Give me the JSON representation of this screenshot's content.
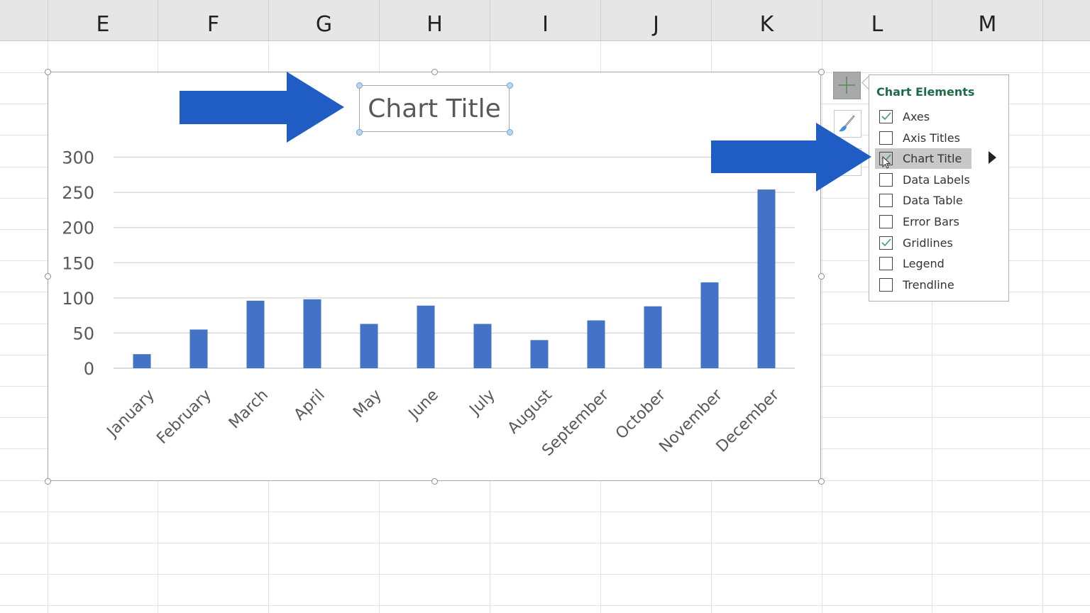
{
  "spreadsheet": {
    "columns": [
      "E",
      "F",
      "G",
      "H",
      "I",
      "J",
      "K",
      "L",
      "M"
    ]
  },
  "chart_data": {
    "type": "bar",
    "title": "Chart Title",
    "categories": [
      "January",
      "February",
      "March",
      "April",
      "May",
      "June",
      "July",
      "August",
      "September",
      "October",
      "November",
      "December"
    ],
    "values": [
      20,
      55,
      96,
      98,
      63,
      89,
      63,
      40,
      68,
      88,
      122,
      254
    ],
    "xlabel": "",
    "ylabel": "",
    "ylim": [
      0,
      300
    ],
    "yticks": [
      0,
      50,
      100,
      150,
      200,
      250,
      300
    ],
    "ytick_labels": [
      "0",
      "50",
      "100",
      "150",
      "200",
      "250",
      "300"
    ],
    "grid": true,
    "legend": "none",
    "bar_color": "#4472c4",
    "x_label_rotation_deg": -45
  },
  "chart_buttons": {
    "plus": "chart-elements-plus",
    "brush": "chart-styles-brush",
    "filter": "chart-filters"
  },
  "chart_elements_panel": {
    "heading": "Chart Elements",
    "items": [
      {
        "label": "Axes",
        "checked": true,
        "hover": false
      },
      {
        "label": "Axis Titles",
        "checked": false,
        "hover": false
      },
      {
        "label": "Chart Title",
        "checked": true,
        "hover": true
      },
      {
        "label": "Data Labels",
        "checked": false,
        "hover": false
      },
      {
        "label": "Data Table",
        "checked": false,
        "hover": false
      },
      {
        "label": "Error Bars",
        "checked": false,
        "hover": false
      },
      {
        "label": "Gridlines",
        "checked": true,
        "hover": false
      },
      {
        "label": "Legend",
        "checked": false,
        "hover": false
      },
      {
        "label": "Trendline",
        "checked": false,
        "hover": false
      }
    ]
  },
  "colors": {
    "accent_arrow": "#1f5cc4",
    "panel_heading": "#1e6b48",
    "checkmark": "#3c9a86"
  }
}
